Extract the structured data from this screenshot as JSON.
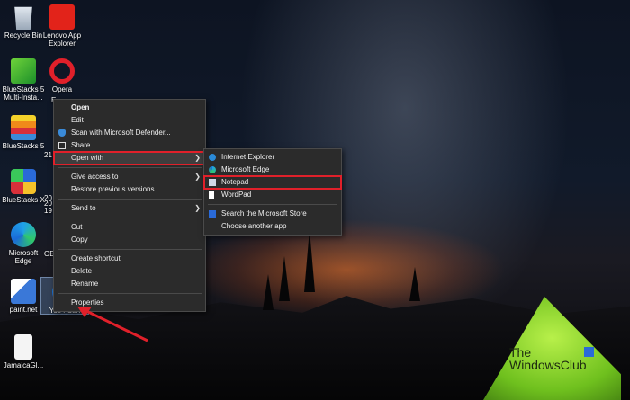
{
  "desktop_icons": [
    {
      "label": "Recycle Bin",
      "icon": "recycle-bin-icon"
    },
    {
      "label": "Lenovo App Explorer",
      "icon": "lenovo-app-explorer-icon"
    },
    {
      "label": "BlueStacks 5 Multi-Insta...",
      "icon": "bluestacks-multi-instance-icon"
    },
    {
      "label": "Opera",
      "icon": "opera-icon"
    },
    {
      "label": "BlueStacks 5",
      "icon": "bluestacks-icon"
    },
    {
      "label": "BlueStacks X",
      "icon": "bluestacks-x-icon"
    },
    {
      "label": "Microsoft Edge",
      "icon": "microsoft-edge-icon"
    },
    {
      "label": "paint.net",
      "icon": "paint-net-icon"
    },
    {
      "label": "Yes I Can",
      "icon": "edge-file-icon"
    },
    {
      "label": "JamaicaGl...",
      "icon": "document-icon"
    }
  ],
  "partial_labels": [
    "E",
    "21",
    "20",
    "20",
    "19",
    "OE"
  ],
  "context_menu": {
    "open": "Open",
    "edit": "Edit",
    "scan": "Scan with Microsoft Defender...",
    "share": "Share",
    "open_with": "Open with",
    "give_access": "Give access to",
    "restore": "Restore previous versions",
    "send_to": "Send to",
    "cut": "Cut",
    "copy": "Copy",
    "create_shortcut": "Create shortcut",
    "delete": "Delete",
    "rename": "Rename",
    "properties": "Properties"
  },
  "submenu": {
    "ie": "Internet Explorer",
    "edge": "Microsoft Edge",
    "notepad": "Notepad",
    "wordpad": "WordPad",
    "store": "Search the Microsoft Store",
    "choose": "Choose another app"
  },
  "watermark": {
    "line1": "The",
    "line2": "WindowsClub"
  },
  "colors": {
    "highlight": "#e0202a",
    "menu_bg": "#2b2b2b",
    "tent": "#7ed321"
  }
}
